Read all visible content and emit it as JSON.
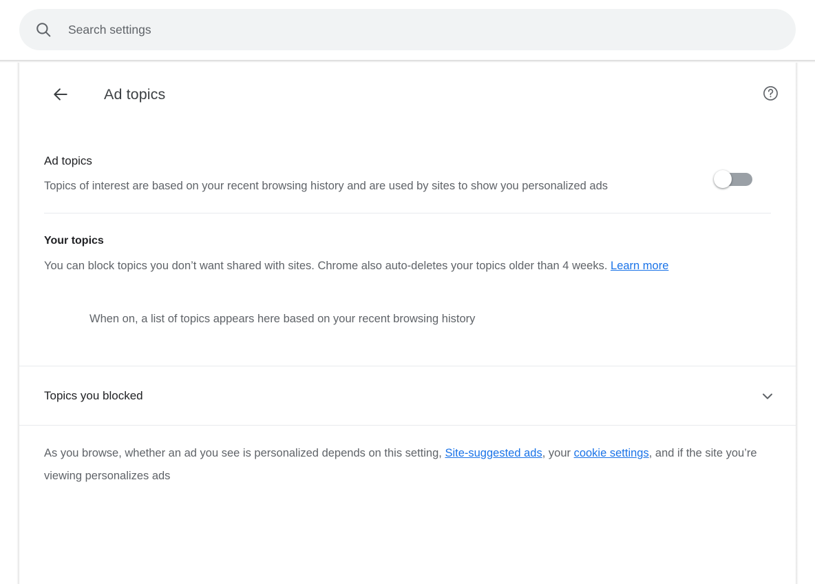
{
  "search": {
    "placeholder": "Search settings",
    "value": "",
    "icon": "search-icon"
  },
  "header": {
    "back_icon": "arrow-left-icon",
    "title": "Ad topics",
    "help_icon": "help-circle-icon"
  },
  "ad_topics": {
    "title": "Ad topics",
    "description": "Topics of interest are based on your recent browsing history and are used by sites to show you personalized ads",
    "toggle": {
      "name": "ad-topics-toggle",
      "state": "off",
      "track_color": "#9aa0a6",
      "knob_color": "#ffffff"
    }
  },
  "your_topics": {
    "title": "Your topics",
    "description_part1": "You can block topics you don’t want shared with sites. Chrome also auto-deletes your topics older than 4 weeks. ",
    "learn_more_label": "Learn more",
    "empty_state": "When on, a list of topics appears here based on your recent browsing history"
  },
  "blocked": {
    "title": "Topics you blocked",
    "expand_icon": "chevron-down-icon",
    "expanded": "false"
  },
  "footer": {
    "part1": "As you browse, whether an ad you see is personalized depends on this setting, ",
    "link1": "Site-suggested ads",
    "part2": ", your ",
    "link2": "cookie settings",
    "part3": ", and if the site you’re viewing personalizes ads"
  },
  "colors": {
    "link": "#1a73e8",
    "body_text": "#5f6368",
    "heading_text": "#202124",
    "divider": "#e8eaed",
    "search_bg": "#f1f3f4"
  }
}
